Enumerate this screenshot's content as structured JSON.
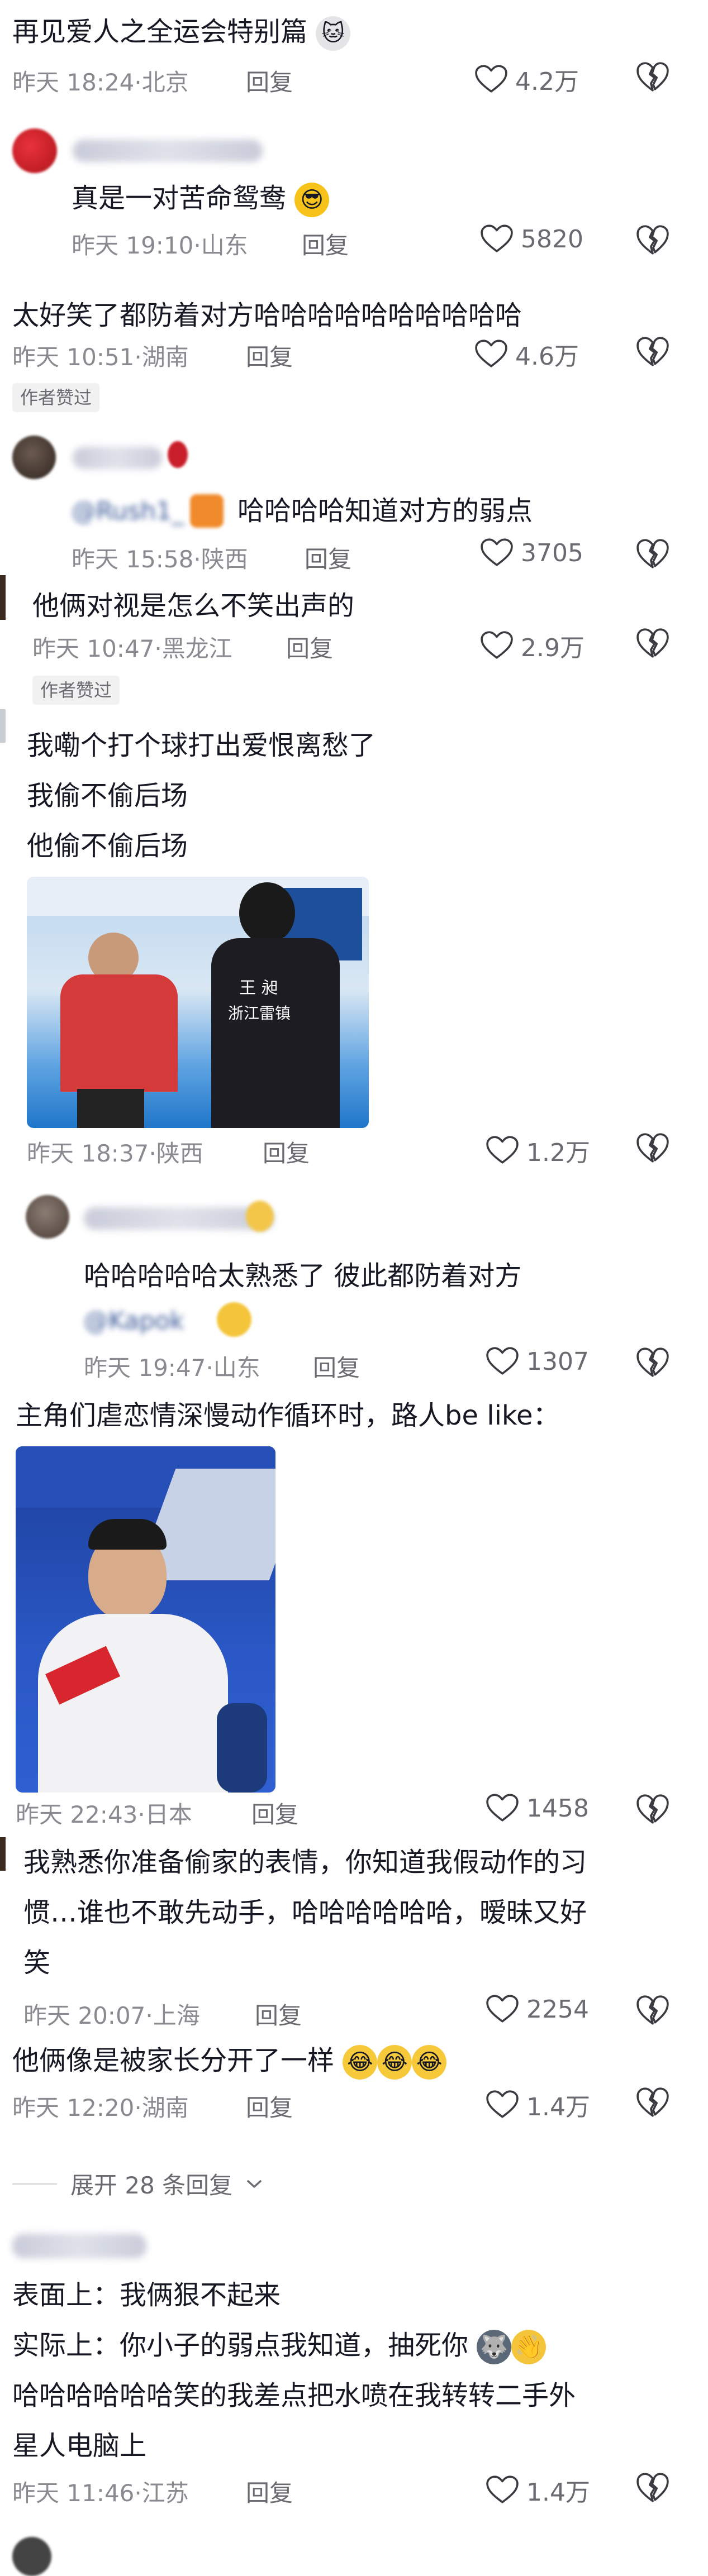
{
  "comments": [
    {
      "text": "再见爱人之全运会特别篇",
      "emoji": "cat-face",
      "time": "昨天 18:24",
      "location": "北京",
      "reply": "回复",
      "likes": "4.2万"
    },
    {
      "text": "真是一对苦命鸳鸯",
      "emoji": "sunglasses-face",
      "time": "昨天 19:10",
      "location": "山东",
      "reply": "回复",
      "likes": "5820"
    },
    {
      "text": "太好笑了都防着对方哈哈哈哈哈哈哈哈哈哈",
      "time": "昨天 10:51",
      "location": "湖南",
      "reply": "回复",
      "likes": "4.6万",
      "badge": "作者赞过"
    },
    {
      "text": "哈哈哈哈知道对方的弱点",
      "mention": "@Rush1_",
      "time": "昨天 15:58",
      "location": "陕西",
      "reply": "回复",
      "likes": "3705"
    },
    {
      "text": "他俩对视是怎么不笑出声的",
      "time": "昨天 10:47",
      "location": "黑龙江",
      "reply": "回复",
      "likes": "2.9万",
      "badge": "作者赞过"
    },
    {
      "lines": [
        "我嘞个打个球打出爱恨离愁了",
        "我偷不偷后场",
        "他偷不偷后场"
      ],
      "image_caption": [
        "王    昶",
        "浙江雷镇"
      ],
      "time": "昨天 18:37",
      "location": "陕西",
      "reply": "回复",
      "likes": "1.2万"
    },
    {
      "text": "哈哈哈哈哈太熟悉了 彼此都防着对方",
      "mention": "@Kapok",
      "time": "昨天 19:47",
      "location": "山东",
      "reply": "回复",
      "likes": "1307"
    },
    {
      "text": "主角们虐恋情深慢动作循环时，路人be like：",
      "time": "昨天 22:43",
      "location": "日本",
      "reply": "回复",
      "likes": "1458"
    },
    {
      "lines": [
        "我熟悉你准备偷家的表情，你知道我假动作的习",
        "惯…谁也不敢先动手，哈哈哈哈哈哈，暧昧又好",
        "笑"
      ],
      "time": "昨天 20:07",
      "location": "上海",
      "reply": "回复",
      "likes": "2254"
    },
    {
      "text": "他俩像是被家长分开了一样",
      "emoji": "crying-face",
      "time": "昨天 12:20",
      "location": "湖南",
      "reply": "回复",
      "likes": "1.4万"
    },
    {
      "lines": [
        "表面上：我俩狠不起来",
        "实际上：你小子的弱点我知道，抽死你",
        "哈哈哈哈哈哈笑的我差点把水喷在我转转二手外",
        "星人电脑上"
      ],
      "time": "昨天 11:46",
      "location": "江苏",
      "reply": "回复",
      "likes": "1.4万"
    }
  ],
  "expand": {
    "label": "展开 28 条回复"
  },
  "colors": {
    "text": "#161823",
    "meta": "#8a8b91",
    "badge_bg": "#f1f1f2"
  }
}
